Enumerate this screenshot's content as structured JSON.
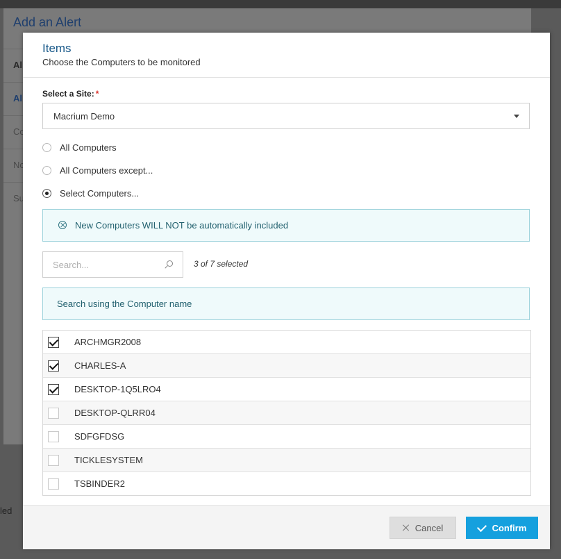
{
  "background": {
    "dialog_title": "Add an Alert",
    "row_fragments": [
      "Al",
      "Al",
      "Co",
      "No",
      "Su"
    ],
    "left_fragment": "led"
  },
  "modal": {
    "title": "Items",
    "subtitle": "Choose the Computers to be monitored"
  },
  "site": {
    "label": "Select a Site:",
    "required_mark": "*",
    "value": "Macrium Demo"
  },
  "radios": [
    {
      "label": "All Computers",
      "selected": false
    },
    {
      "label": "All Computers except...",
      "selected": false
    },
    {
      "label": "Select Computers...",
      "selected": true
    }
  ],
  "notice": "New Computers WILL NOT be automatically included",
  "search": {
    "placeholder": "Search...",
    "count": "3 of 7 selected",
    "hint": "Search using the Computer name"
  },
  "computers": [
    {
      "name": "ARCHMGR2008",
      "checked": true
    },
    {
      "name": "CHARLES-A",
      "checked": true
    },
    {
      "name": "DESKTOP-1Q5LRO4",
      "checked": true
    },
    {
      "name": "DESKTOP-QLRR04",
      "checked": false
    },
    {
      "name": "SDFGFDSG",
      "checked": false
    },
    {
      "name": "TICKLESYSTEM",
      "checked": false
    },
    {
      "name": "TSBINDER2",
      "checked": false
    }
  ],
  "footer": {
    "cancel_label": "Cancel",
    "confirm_label": "Confirm"
  },
  "colors": {
    "accent": "#15a0de",
    "title": "#1a5a8a",
    "info_bg": "#effafb",
    "info_border": "#9ed3dc",
    "required": "#d9302a"
  }
}
